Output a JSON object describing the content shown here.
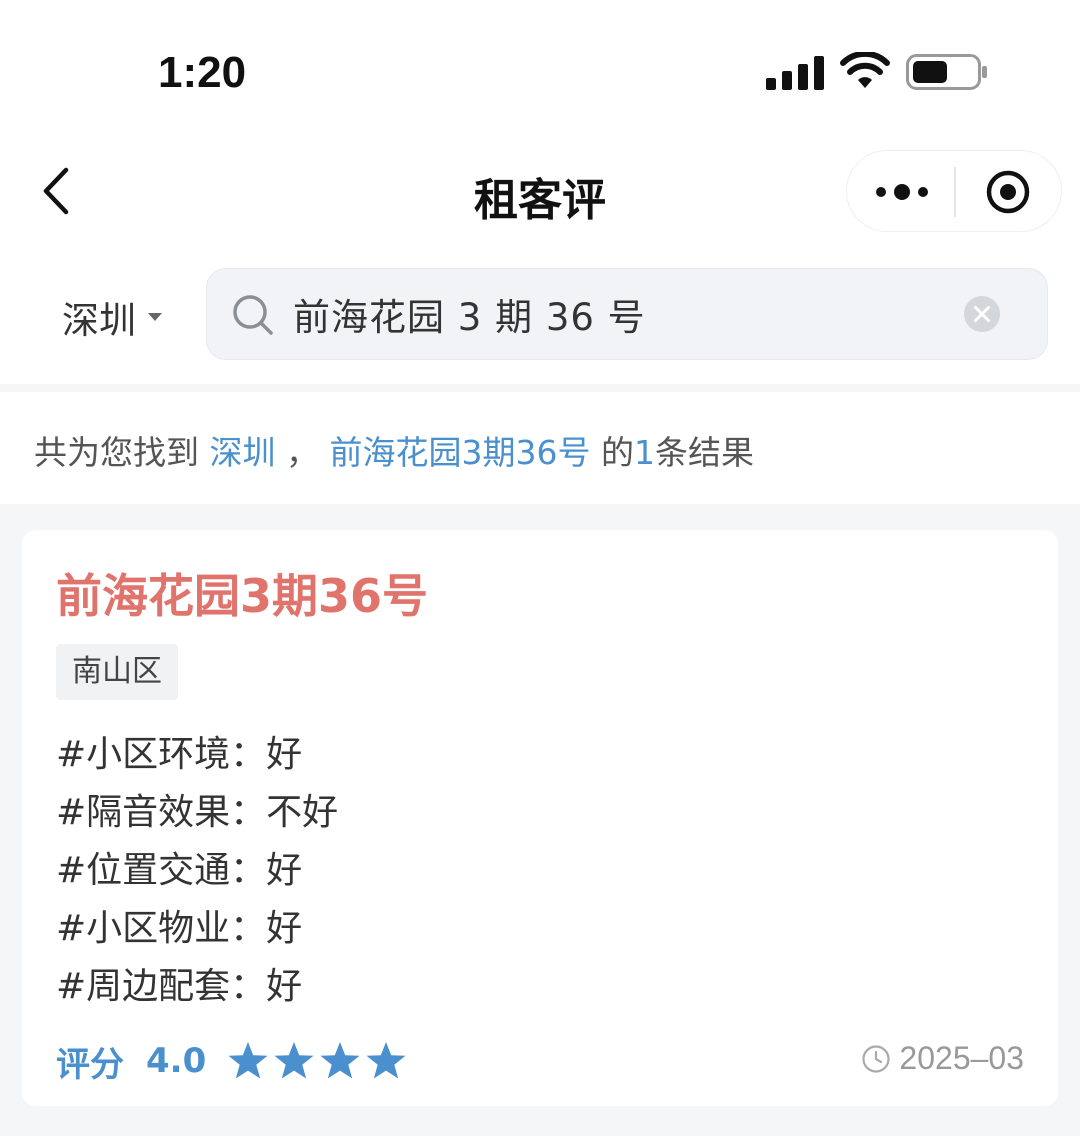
{
  "status_bar": {
    "time": "1:20"
  },
  "nav": {
    "title": "租客评"
  },
  "search": {
    "city": "深圳",
    "query": "前海花园 3 期 36 号"
  },
  "summary": {
    "prefix": "共为您找到",
    "city": "深圳",
    "sep": "，",
    "keyword": "前海花园3期36号",
    "mid": "的",
    "count": "1",
    "suffix": "条结果"
  },
  "result": {
    "title": "前海花园3期36号",
    "district": "南山区",
    "tags": [
      {
        "text": "#小区环境：好"
      },
      {
        "text": "#隔音效果：不好"
      },
      {
        "text": "#位置交通：好"
      },
      {
        "text": "#小区物业：好"
      },
      {
        "text": "#周边配套：好"
      }
    ],
    "score_label": "评分",
    "score": "4.0",
    "stars": 4,
    "date": "2025–03"
  },
  "colors": {
    "accent": "#4a8fce",
    "title_red": "#e0736c",
    "background": "#f5f6f7"
  }
}
